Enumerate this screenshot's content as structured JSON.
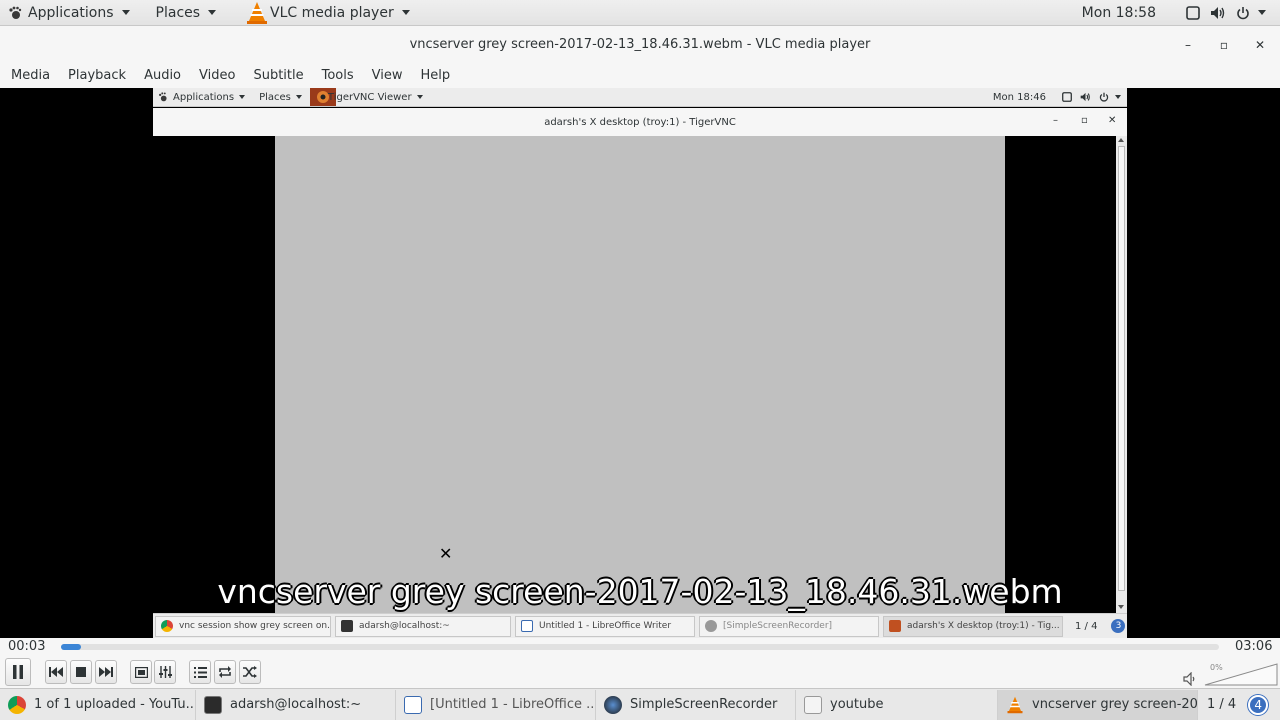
{
  "topbar": {
    "applications": "Applications",
    "places": "Places",
    "app_name": "VLC media player",
    "clock": "Mon 18:58"
  },
  "window": {
    "title": "vncserver grey screen-2017-02-13_18.46.31.webm - VLC media player",
    "minimize": "–",
    "maximize": "▫",
    "close": "✕"
  },
  "menubar": {
    "items": [
      "Media",
      "Playback",
      "Audio",
      "Video",
      "Subtitle",
      "Tools",
      "View",
      "Help"
    ]
  },
  "video": {
    "inner_topbar": {
      "applications": "Applications",
      "places": "Places",
      "app_name": "TigerVNC Viewer",
      "clock": "Mon 18:46"
    },
    "inner_title": "adarsh's X desktop (troy:1) - TigerVNC",
    "inner_tasks": [
      "vnc session show grey screen on...",
      "adarsh@localhost:~",
      "Untitled 1 - LibreOffice Writer",
      "[SimpleScreenRecorder]",
      "adarsh's X desktop (troy:1) - Tig..."
    ],
    "inner_pager": "1 / 4",
    "inner_workspace": "3",
    "subtitle": "vncserver grey screen-2017-02-13_18.46.31.webm"
  },
  "player": {
    "time_elapsed": "00:03",
    "time_total": "03:06",
    "progress": 0.016,
    "volume_label": "0%"
  },
  "taskbar": {
    "items": [
      "1 of 1 uploaded - YouTu...",
      "adarsh@localhost:~",
      "[Untitled 1 - LibreOffice ...",
      "SimpleScreenRecorder",
      "youtube",
      "vncserver grey screen-20..."
    ],
    "pager": "1 / 4",
    "workspace": "4"
  },
  "colors": {
    "accent": "#3b85d6",
    "video_bg": "#000000",
    "grey_screen": "#c0c0c0",
    "vlc_orange": "#f08000"
  }
}
